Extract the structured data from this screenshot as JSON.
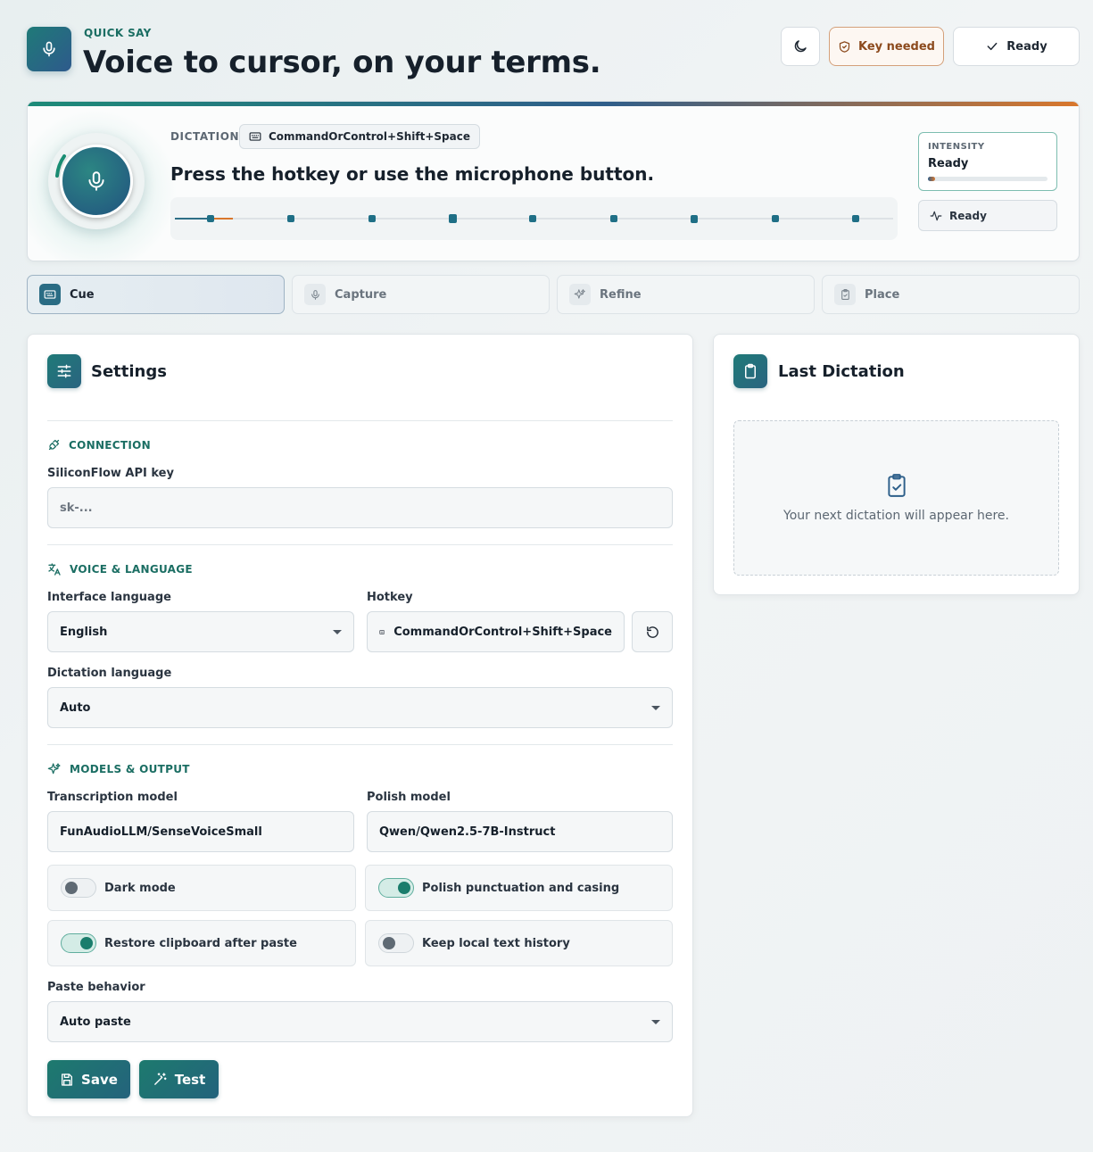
{
  "header": {
    "eyebrow": "QUICK SAY",
    "title": "Voice to cursor, on your terms.",
    "key_status": "Key needed",
    "ready_status": "Ready"
  },
  "hero": {
    "dictation_label": "DICTATION",
    "hotkey": "CommandOrControl+Shift+Space",
    "message": "Press the hotkey or use the microphone button.",
    "intensity_label": "INTENSITY",
    "intensity_value": "Ready",
    "intensity_level": 0.06,
    "status": "Ready"
  },
  "steps": [
    {
      "label": "Cue",
      "icon": "keyboard-icon",
      "active": true
    },
    {
      "label": "Capture",
      "icon": "mic-icon",
      "active": false
    },
    {
      "label": "Refine",
      "icon": "sparkles-icon",
      "active": false
    },
    {
      "label": "Place",
      "icon": "clipboard-check-icon",
      "active": false
    }
  ],
  "settings": {
    "title": "Settings",
    "connection": {
      "heading": "CONNECTION",
      "api_key_label": "SiliconFlow API key",
      "api_key_placeholder": "sk-..."
    },
    "voice": {
      "heading": "VOICE & LANGUAGE",
      "interface_language_label": "Interface language",
      "interface_language": "English",
      "hotkey_label": "Hotkey",
      "hotkey": "CommandOrControl+Shift+Space",
      "dictation_language_label": "Dictation language",
      "dictation_language": "Auto"
    },
    "models": {
      "heading": "MODELS & OUTPUT",
      "transcription_label": "Transcription model",
      "transcription_model": "FunAudioLLM/SenseVoiceSmall",
      "polish_label": "Polish model",
      "polish_model": "Qwen/Qwen2.5-7B-Instruct"
    },
    "toggles": {
      "dark_mode": {
        "label": "Dark mode",
        "on": false
      },
      "polish": {
        "label": "Polish punctuation and casing",
        "on": true
      },
      "restore_clipboard": {
        "label": "Restore clipboard after paste",
        "on": true
      },
      "history": {
        "label": "Keep local text history",
        "on": false
      }
    },
    "paste_label": "Paste behavior",
    "paste_behavior": "Auto paste",
    "save_label": "Save",
    "test_label": "Test"
  },
  "last_dictation": {
    "title": "Last Dictation",
    "empty_text": "Your next dictation will appear here."
  },
  "colors": {
    "accent": "#1b6e63",
    "brand_gradient_start": "#1f7a78",
    "brand_gradient_end": "#2e5a8c",
    "warning": "#8c4a1d"
  }
}
